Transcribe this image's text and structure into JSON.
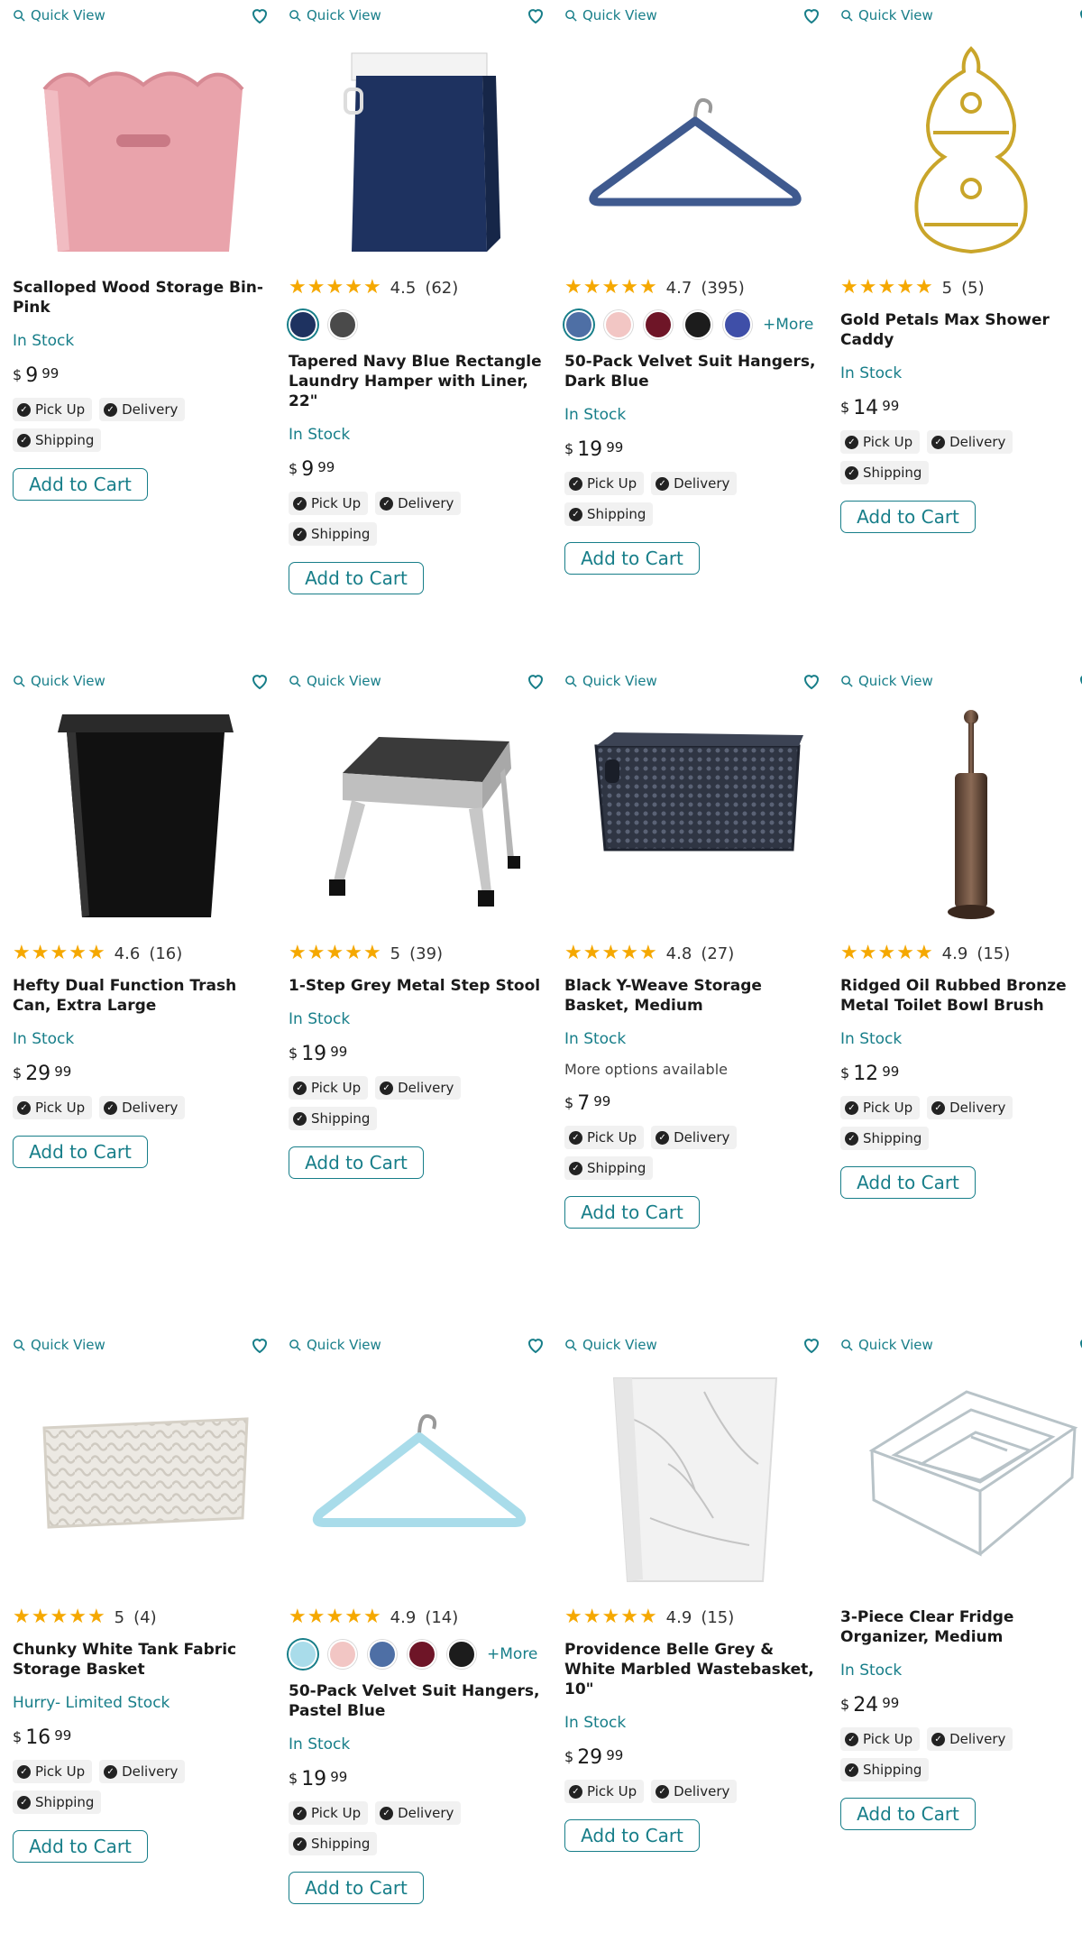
{
  "colors": {
    "accent": "#177e89",
    "star": "#f5a800"
  },
  "labels": {
    "quick_view": "Quick View",
    "add_to_cart": "Add to Cart",
    "pick_up": "Pick Up",
    "delivery": "Delivery",
    "shipping": "Shipping",
    "currency": "$",
    "more": "+More"
  },
  "products": [
    {
      "title": "Scalloped Wood Storage Bin- Pink",
      "stock": "In Stock",
      "price_dollars": "9",
      "price_cents": "99"
    },
    {
      "title": "Tapered Navy Blue Rectangle Laundry Hamper with Liner, 22\"",
      "rating": "4.5",
      "reviews": "(62)",
      "stock": "In Stock",
      "price_dollars": "9",
      "price_cents": "99"
    },
    {
      "title": "50-Pack Velvet Suit Hangers, Dark Blue",
      "rating": "4.7",
      "reviews": "(395)",
      "stock": "In Stock",
      "price_dollars": "19",
      "price_cents": "99"
    },
    {
      "title": "Gold Petals Max Shower Caddy",
      "rating": "5",
      "reviews": "(5)",
      "stock": "In Stock",
      "price_dollars": "14",
      "price_cents": "99"
    },
    {
      "title": "Hefty Dual Function Trash Can, Extra Large",
      "rating": "4.6",
      "reviews": "(16)",
      "stock": "In Stock",
      "price_dollars": "29",
      "price_cents": "99"
    },
    {
      "title": "1-Step Grey Metal Step Stool",
      "rating": "5",
      "reviews": "(39)",
      "stock": "In Stock",
      "price_dollars": "19",
      "price_cents": "99"
    },
    {
      "title": "Black Y-Weave Storage Basket, Medium",
      "rating": "4.8",
      "reviews": "(27)",
      "stock": "In Stock",
      "options_note": "More options available",
      "price_dollars": "7",
      "price_cents": "99"
    },
    {
      "title": "Ridged Oil Rubbed Bronze Metal Toilet Bowl Brush",
      "rating": "4.9",
      "reviews": "(15)",
      "stock": "In Stock",
      "price_dollars": "12",
      "price_cents": "99"
    },
    {
      "title": "Chunky White Tank Fabric Storage Basket",
      "rating": "5",
      "reviews": "(4)",
      "stock": "Hurry- Limited Stock",
      "price_dollars": "16",
      "price_cents": "99"
    },
    {
      "title": "50-Pack Velvet Suit Hangers, Pastel Blue",
      "rating": "4.9",
      "reviews": "(14)",
      "stock": "In Stock",
      "price_dollars": "19",
      "price_cents": "99"
    },
    {
      "title": "Providence Belle Grey & White Marbled Wastebasket, 10\"",
      "rating": "4.9",
      "reviews": "(15)",
      "stock": "In Stock",
      "price_dollars": "29",
      "price_cents": "99"
    },
    {
      "title": "3-Piece Clear Fridge Organizer, Medium",
      "stock": "In Stock",
      "price_dollars": "24",
      "price_cents": "99"
    }
  ],
  "swatch_colors": {
    "hamper": [
      "#1e3260",
      "#4a4a4a"
    ],
    "hangers_dark": [
      "#4e6fa5",
      "#f2c6c4",
      "#6e1527",
      "#1c1c1c",
      "#3f4fa8"
    ],
    "hangers_pastel": [
      "#a9dcea",
      "#f2c6c4",
      "#4e6fa5",
      "#6e1527",
      "#1c1c1c"
    ]
  }
}
